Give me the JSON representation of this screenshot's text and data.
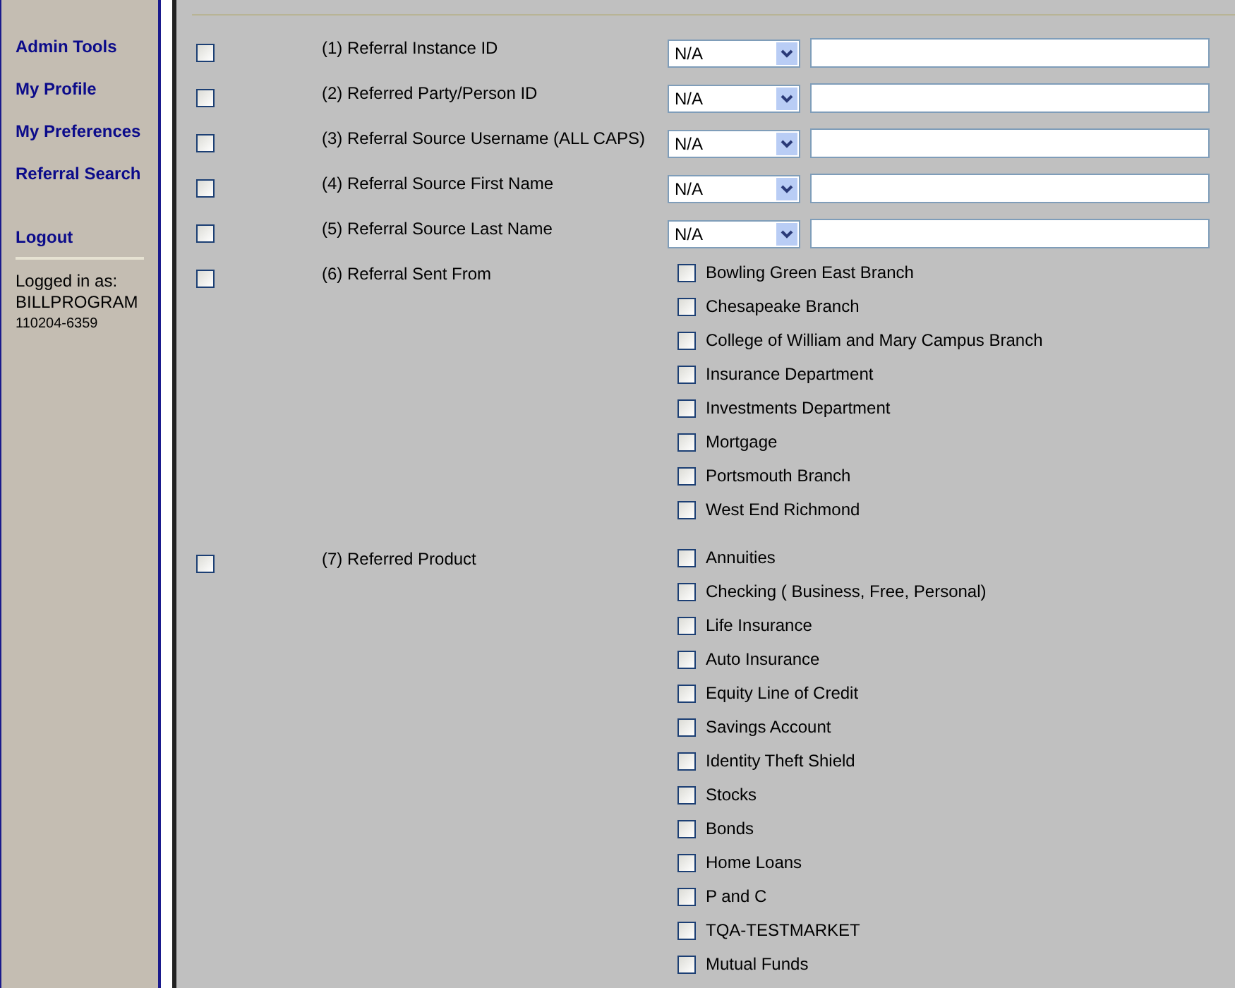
{
  "sidebar": {
    "links": [
      "Admin Tools",
      "My Profile",
      "My Preferences",
      "Referral Search"
    ],
    "logout": "Logout",
    "logged_in_label": "Logged in as:",
    "username": "BILLPROGRAM",
    "user_code": "110204-6359"
  },
  "criteria": [
    {
      "kind": "text",
      "label": "(1) Referral Instance ID",
      "checked": false,
      "operator": "N/A"
    },
    {
      "kind": "text",
      "label": "(2) Referred Party/Person ID",
      "checked": false,
      "operator": "N/A"
    },
    {
      "kind": "text",
      "label": "(3) Referral Source Username (ALL CAPS)",
      "checked": false,
      "operator": "N/A"
    },
    {
      "kind": "text",
      "label": "(4) Referral Source First Name",
      "checked": false,
      "operator": "N/A"
    },
    {
      "kind": "text",
      "label": "(5) Referral Source Last Name",
      "checked": false,
      "operator": "N/A"
    },
    {
      "kind": "multi",
      "label": "(6) Referral Sent From",
      "checked": false,
      "options": [
        {
          "label": "Bowling Green East Branch",
          "checked": false
        },
        {
          "label": "Chesapeake Branch",
          "checked": false
        },
        {
          "label": "College of William and Mary Campus Branch",
          "checked": false
        },
        {
          "label": "Insurance Department",
          "checked": false
        },
        {
          "label": "Investments Department",
          "checked": false
        },
        {
          "label": "Mortgage",
          "checked": false
        },
        {
          "label": "Portsmouth Branch",
          "checked": false
        },
        {
          "label": "West End Richmond",
          "checked": false
        }
      ]
    },
    {
      "kind": "multi",
      "label": "(7) Referred Product",
      "checked": false,
      "options": [
        {
          "label": "Annuities",
          "checked": false
        },
        {
          "label": "Checking ( Business, Free, Personal)",
          "checked": false
        },
        {
          "label": "Life Insurance",
          "checked": false
        },
        {
          "label": "Auto Insurance",
          "checked": false
        },
        {
          "label": "Equity Line of Credit",
          "checked": false
        },
        {
          "label": "Savings Account",
          "checked": false
        },
        {
          "label": "Identity Theft Shield",
          "checked": false
        },
        {
          "label": "Stocks",
          "checked": false
        },
        {
          "label": "Bonds",
          "checked": false
        },
        {
          "label": "Home Loans",
          "checked": false
        },
        {
          "label": "P and C",
          "checked": false
        },
        {
          "label": "TQA-TESTMARKET",
          "checked": false
        },
        {
          "label": "Mutual Funds",
          "checked": false
        }
      ]
    }
  ]
}
